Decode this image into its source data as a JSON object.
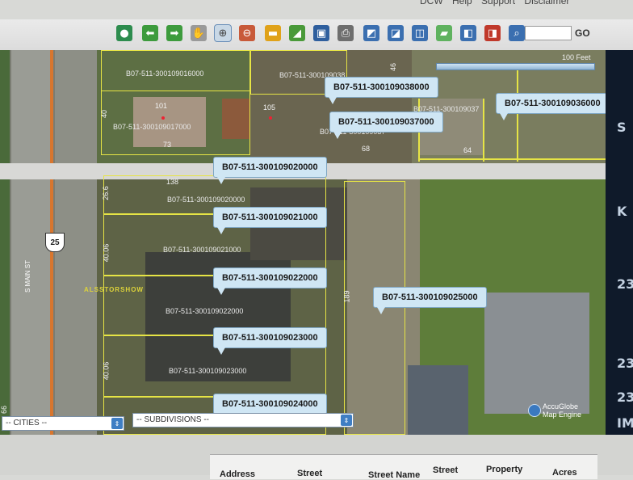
{
  "top_menu": [
    "DCW",
    "Help",
    "Support",
    "Disclaimer"
  ],
  "toolbar": {
    "tools": [
      {
        "icon": "globe-icon",
        "color": "#2d8c4e",
        "glyph": "●"
      },
      {
        "icon": "arrow-left-icon",
        "color": "#3d9b3d",
        "glyph": "⬅"
      },
      {
        "icon": "arrow-right-icon",
        "color": "#3d9b3d",
        "glyph": "➡"
      },
      {
        "icon": "pan-hand-icon",
        "color": "#9a9a9a",
        "glyph": "✋"
      },
      {
        "icon": "zoom-in-icon",
        "color": "#6c8a3c",
        "glyph": "⊕",
        "active": true
      },
      {
        "icon": "zoom-out-icon",
        "color": "#c85a3a",
        "glyph": "⊖"
      },
      {
        "icon": "measure-ruler-icon",
        "color": "#e0a21a",
        "glyph": "▬"
      },
      {
        "icon": "area-measure-icon",
        "color": "#4a9a3a",
        "glyph": "◢"
      },
      {
        "icon": "save-icon",
        "color": "#2f5f9e",
        "glyph": "▣"
      },
      {
        "icon": "print-icon",
        "color": "#6e6e6e",
        "glyph": "⎙"
      },
      {
        "icon": "select-icon",
        "color": "#3b6fb0",
        "glyph": "◩"
      },
      {
        "icon": "identify-icon",
        "color": "#3b6fb0",
        "glyph": "◪"
      },
      {
        "icon": "edit-icon",
        "color": "#3b6fb0",
        "glyph": "◫"
      },
      {
        "icon": "comment-icon",
        "color": "#5fb25f",
        "glyph": "▰"
      },
      {
        "icon": "label-icon",
        "color": "#3b6fb0",
        "glyph": "◧"
      },
      {
        "icon": "clear-icon",
        "color": "#c0392b",
        "glyph": "◨"
      },
      {
        "icon": "search-icon",
        "color": "#3b6fb0",
        "glyph": "⌕"
      }
    ],
    "go_label": "GO",
    "search_value": ""
  },
  "map": {
    "scale_label": "100 Feet",
    "route_shield": "25",
    "street_label": "S MAIN ST",
    "faded_label": "ALSSTORSHOW",
    "attribution_line1": "AccuGlobe",
    "attribution_line2": "Map Engine",
    "right_edge_fragments": [
      "S",
      "K",
      "23",
      "23",
      "23",
      "IM"
    ],
    "lot_numbers": [
      "101",
      "105",
      "73",
      "68",
      "64",
      "46",
      "40",
      "138",
      "26.6",
      "40.06",
      "40.06",
      "189",
      "66"
    ],
    "parcel_texts": [
      "B07-511-300109016000",
      "B07-511-300109017000",
      "B07-511-300109020000",
      "B07-511-300109021000",
      "B07-511-300109022000",
      "B07-511-300109023000",
      "B07-511-300109037",
      "B07-511-300109037",
      "B07-511-300109038"
    ],
    "callouts": [
      "B07-511-300109038000",
      "B07-511-300109037000",
      "B07-511-300109036000",
      "B07-511-300109020000",
      "B07-511-300109021000",
      "B07-511-300109022000",
      "B07-511-300109025000",
      "B07-511-300109023000",
      "B07-511-300109024000"
    ]
  },
  "selects": {
    "cities": "-- CITIES --",
    "subdivisions": "-- SUBDIVISIONS --"
  },
  "results_headers": [
    "Address",
    "Street",
    "Street Name",
    "Street",
    "Property",
    "Acres"
  ]
}
